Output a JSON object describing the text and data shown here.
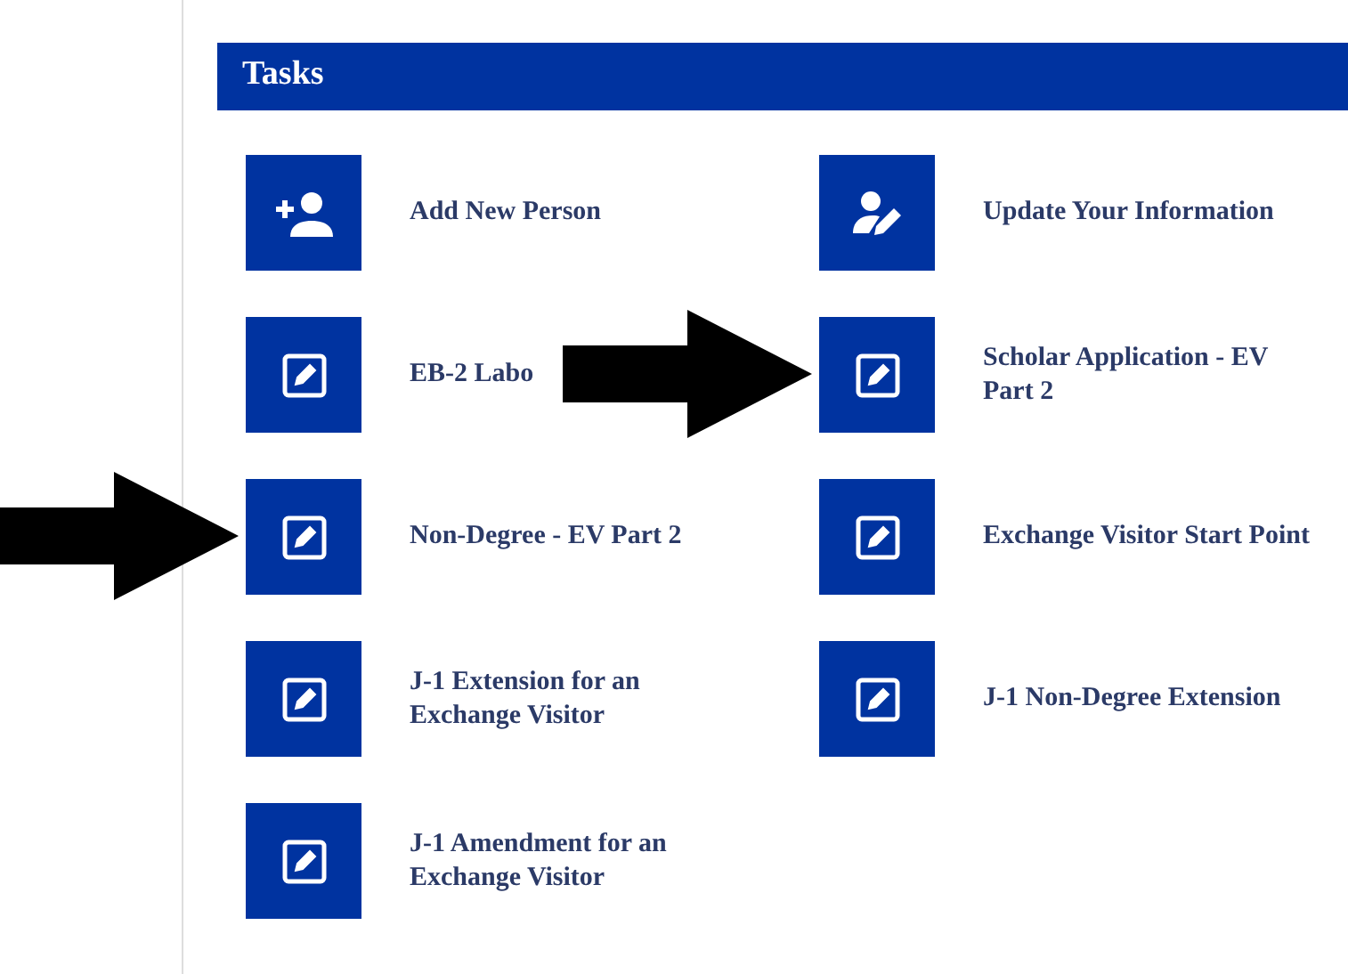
{
  "panel": {
    "title": "Tasks"
  },
  "tasks": [
    {
      "label": "Add New Person",
      "kind": "add-person",
      "arrow_points_here": false
    },
    {
      "label": "Update Your Information",
      "kind": "edit-person",
      "arrow_points_here": false
    },
    {
      "label": "EB-2 Labo",
      "kind": "edit",
      "arrow_points_here": false
    },
    {
      "label": "Scholar Application - EV Part 2",
      "kind": "edit",
      "arrow_points_here": true
    },
    {
      "label": "Non-Degree - EV Part 2",
      "kind": "edit",
      "arrow_points_here": true
    },
    {
      "label": "Exchange Visitor Start Point",
      "kind": "edit",
      "arrow_points_here": false
    },
    {
      "label": "J-1 Extension for an Exchange Visitor",
      "kind": "edit",
      "arrow_points_here": false
    },
    {
      "label": "J-1 Non-Degree Extension",
      "kind": "edit",
      "arrow_points_here": false
    },
    {
      "label": "J-1 Amendment for an Exchange Visitor",
      "kind": "edit",
      "arrow_points_here": false
    }
  ]
}
